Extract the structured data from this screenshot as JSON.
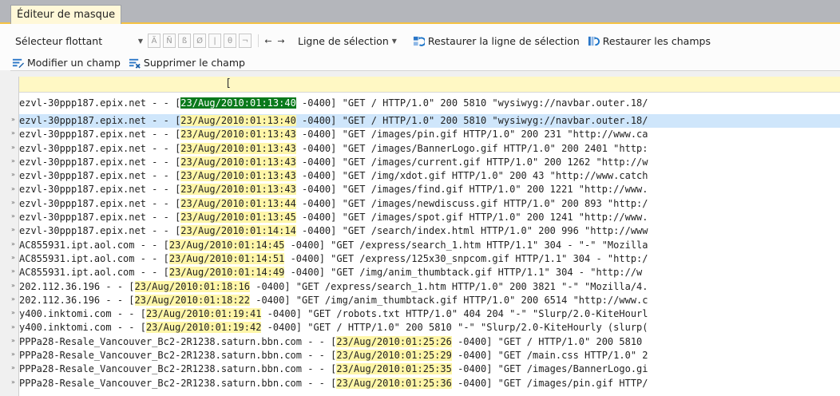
{
  "tab": {
    "title": "Éditeur de masque"
  },
  "toolbar": {
    "selector": "Sélecteur flottant",
    "char_buttons": [
      "Ã",
      "Ñ",
      "ß",
      "Ø",
      "|",
      "θ",
      "¬"
    ],
    "nav_left": "←",
    "nav_right": "→",
    "selection_line": "Ligne de sélection",
    "restore_line": "Restaurer la ligne de sélection",
    "restore_fields": "Restaurer les champs",
    "modify_field": "Modifier un champ",
    "delete_field": "Supprimer le champ"
  },
  "editor": {
    "ruler_mark": "[",
    "mask_line": {
      "pre": "ezvl-30ppp187.epix.net - - [",
      "field": "23/Aug/2010:01:13:40",
      "post": " -0400] \"GET / HTTP/1.0\" 200 5810 \"wysiwyg://navbar.outer.18/"
    },
    "records": [
      {
        "pre": "ezvl-30ppp187.epix.net - - [",
        "date": "23/Aug/2010:01:13:40",
        "post": " -0400] \"GET / HTTP/1.0\" 200 5810 \"wysiwyg://navbar.outer.18/",
        "selected": true
      },
      {
        "pre": "ezvl-30ppp187.epix.net - - [",
        "date": "23/Aug/2010:01:13:43",
        "post": " -0400] \"GET /images/pin.gif HTTP/1.0\" 200 231 \"http://www.ca"
      },
      {
        "pre": "ezvl-30ppp187.epix.net - - [",
        "date": "23/Aug/2010:01:13:43",
        "post": " -0400] \"GET /images/BannerLogo.gif HTTP/1.0\" 200 2401 \"http:"
      },
      {
        "pre": "ezvl-30ppp187.epix.net - - [",
        "date": "23/Aug/2010:01:13:43",
        "post": " -0400] \"GET /images/current.gif HTTP/1.0\" 200 1262 \"http://w"
      },
      {
        "pre": "ezvl-30ppp187.epix.net - - [",
        "date": "23/Aug/2010:01:13:43",
        "post": " -0400] \"GET /img/xdot.gif HTTP/1.0\" 200 43 \"http://www.catch"
      },
      {
        "pre": "ezvl-30ppp187.epix.net - - [",
        "date": "23/Aug/2010:01:13:43",
        "post": " -0400] \"GET /images/find.gif HTTP/1.0\" 200 1221 \"http://www."
      },
      {
        "pre": "ezvl-30ppp187.epix.net - - [",
        "date": "23/Aug/2010:01:13:44",
        "post": " -0400] \"GET /images/newdiscuss.gif HTTP/1.0\" 200 893 \"http:/"
      },
      {
        "pre": "ezvl-30ppp187.epix.net - - [",
        "date": "23/Aug/2010:01:13:45",
        "post": " -0400] \"GET /images/spot.gif HTTP/1.0\" 200 1241 \"http://www."
      },
      {
        "pre": "ezvl-30ppp187.epix.net - - [",
        "date": "23/Aug/2010:01:14:14",
        "post": " -0400] \"GET /search/index.html HTTP/1.0\" 200 996 \"http://www"
      },
      {
        "pre": "AC855931.ipt.aol.com - - [",
        "date": "23/Aug/2010:01:14:45",
        "post": " -0400] \"GET /express/search_1.htm HTTP/1.1\" 304 - \"-\" \"Mozilla"
      },
      {
        "pre": "AC855931.ipt.aol.com - - [",
        "date": "23/Aug/2010:01:14:51",
        "post": " -0400] \"GET /express/125x30_snpcom.gif HTTP/1.1\" 304 - \"http:/"
      },
      {
        "pre": "AC855931.ipt.aol.com - - [",
        "date": "23/Aug/2010:01:14:49",
        "post": " -0400] \"GET /img/anim_thumbtack.gif HTTP/1.1\" 304 - \"http://w"
      },
      {
        "pre": "202.112.36.196 - - [",
        "date": "23/Aug/2010:01:18:16",
        "post": " -0400] \"GET /express/search_1.htm HTTP/1.0\" 200 3821 \"-\" \"Mozilla/4."
      },
      {
        "pre": "202.112.36.196 - - [",
        "date": "23/Aug/2010:01:18:22",
        "post": " -0400] \"GET /img/anim_thumbtack.gif HTTP/1.0\" 200 6514 \"http://www.c"
      },
      {
        "pre": "y400.inktomi.com - - [",
        "date": "23/Aug/2010:01:19:41",
        "post": " -0400] \"GET /robots.txt HTTP/1.0\" 404 204 \"-\" \"Slurp/2.0-KiteHourl"
      },
      {
        "pre": "y400.inktomi.com - - [",
        "date": "23/Aug/2010:01:19:42",
        "post": " -0400] \"GET / HTTP/1.0\" 200 5810 \"-\" \"Slurp/2.0-KiteHourly (slurp("
      },
      {
        "pre": "PPPa28-Resale_Vancouver_Bc2-2R1238.saturn.bbn.com - - [",
        "date": "23/Aug/2010:01:25:26",
        "post": " -0400] \"GET / HTTP/1.0\" 200 5810"
      },
      {
        "pre": "PPPa28-Resale_Vancouver_Bc2-2R1238.saturn.bbn.com - - [",
        "date": "23/Aug/2010:01:25:29",
        "post": " -0400] \"GET /main.css HTTP/1.0\" 2"
      },
      {
        "pre": "PPPa28-Resale_Vancouver_Bc2-2R1238.saturn.bbn.com - - [",
        "date": "23/Aug/2010:01:25:35",
        "post": " -0400] \"GET /images/BannerLogo.gi"
      },
      {
        "pre": "PPPa28-Resale_Vancouver_Bc2-2R1238.saturn.bbn.com - - [",
        "date": "23/Aug/2010:01:25:36",
        "post": " -0400] \"GET /images/pin.gif HTTP/"
      }
    ]
  },
  "icons": {
    "restore_line": "restore-line-icon",
    "restore_fields": "restore-fields-icon",
    "modify_field": "modify-field-icon",
    "delete_field": "delete-field-icon",
    "row_marker": "row-marker-icon",
    "accent": "#1a73c8"
  }
}
